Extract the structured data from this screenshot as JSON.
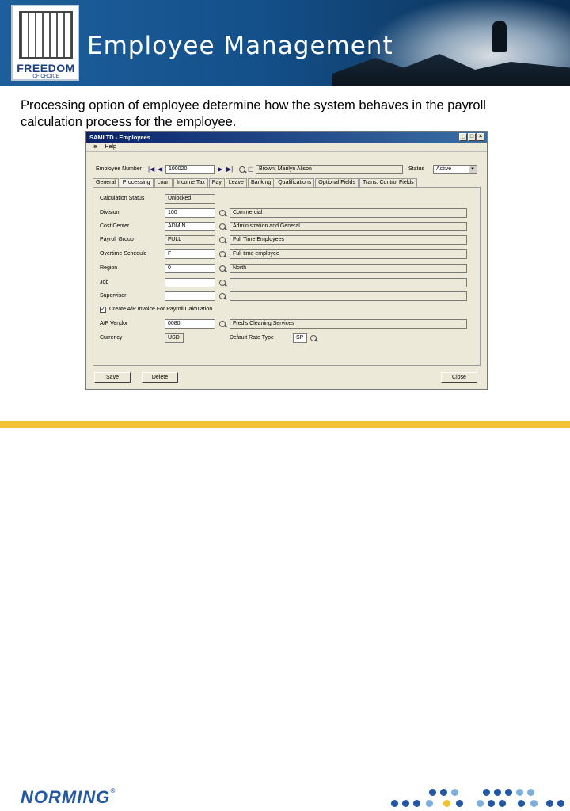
{
  "banner": {
    "title": "Employee Management",
    "logo_text": "FREEDOM",
    "logo_sub": "OF CHOICE"
  },
  "description": "Processing option of employee determine how the system behaves in the payroll calculation process for the employee.",
  "window": {
    "title": "SAMLTD - Employees",
    "menu": [
      "le",
      "Help"
    ],
    "employee_number_label": "Employee Number",
    "employee_number": "100020",
    "employee_name": "Brown, Marilyn Alison",
    "status_label": "Status",
    "status_value": "Active",
    "tabs": [
      "General",
      "Processing",
      "Loan",
      "Income Tax",
      "Pay",
      "Leave",
      "Banking",
      "Qualifications",
      "Optional Fields",
      "Trans. Control Fields"
    ],
    "active_tab": "Processing",
    "calculation_status_label": "Calculation Status",
    "calculation_status": "Unlocked",
    "rows": [
      {
        "label": "Division",
        "code": "100",
        "desc": "Commercial"
      },
      {
        "label": "Cost Center",
        "code": "ADMIN",
        "desc": "Administration and General"
      },
      {
        "label": "Payroll Group",
        "code": "FULL",
        "desc": "Full Time Employees"
      },
      {
        "label": "Overtime Schedule",
        "code": "F",
        "desc": "Full time employee"
      },
      {
        "label": "Region",
        "code": "0",
        "desc": "North"
      },
      {
        "label": "Job",
        "code": "",
        "desc": ""
      },
      {
        "label": "Supervisor",
        "code": "",
        "desc": ""
      }
    ],
    "create_invoice_label": "Create A/P Invoice For Payroll Calculation",
    "create_invoice_checked": true,
    "ap_vendor_label": "A/P Vendor",
    "ap_vendor": "0080",
    "ap_vendor_desc": "Fred's Cleaning Services",
    "currency_label": "Currency",
    "currency": "USD",
    "default_rate_type_label": "Default Rate Type",
    "default_rate_type": "SP",
    "save_label": "Save",
    "delete_label": "Delete",
    "close_label": "Close"
  },
  "footer": {
    "brand": "NORMING",
    "reg": "®"
  },
  "colors": {
    "banner": "#1d5f9c",
    "gold": "#f1c232",
    "brand": "#2456a4",
    "titlebar": "#0a246a"
  }
}
